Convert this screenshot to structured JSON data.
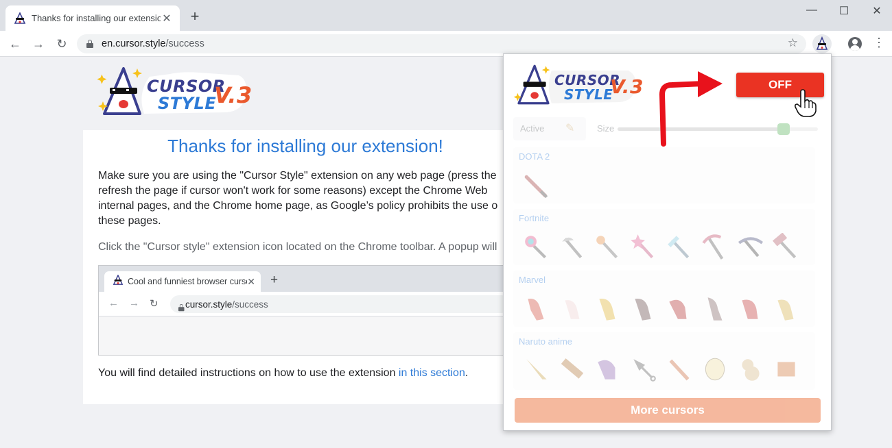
{
  "browser": {
    "tab_title": "Thanks for installing our extension",
    "url_host": "en.cursor.style",
    "url_path": "/success"
  },
  "page": {
    "logo": {
      "line1": "CURSOR",
      "line2": "STYLE",
      "version": "V.3"
    },
    "heading": "Thanks for installing our extension!",
    "para1": [
      "Make sure you are using the \"Cursor Style\" extension on any web page (press the",
      "refresh the page if cursor won't work for some reasons) except the Chrome Web",
      "internal pages, and the Chrome home page, as Google’s policy prohibits the use o",
      "these pages."
    ],
    "para2": "Click the \"Cursor style\" extension icon located on the Chrome toolbar. A popup will",
    "para3_prefix": "You will find detailed instructions on how to use the extension ",
    "para3_link": "in this section",
    "para3_suffix": "."
  },
  "mini_browser": {
    "tab_title": "Cool and funniest browser cursors",
    "url_host": "cursor.style",
    "url_path": "/success"
  },
  "popup": {
    "off_label": "OFF",
    "active_label": "Active",
    "size_label": "Size",
    "size_value": 0.85,
    "categories": [
      {
        "name": "DOTA 2",
        "count": 1
      },
      {
        "name": "Fortnite",
        "count": 8
      },
      {
        "name": "Marvel",
        "count": 8
      },
      {
        "name": "Naruto anime",
        "count": 8
      }
    ],
    "more_label": "More cursors"
  },
  "colors": {
    "accent": "#2d7ad6",
    "off_red": "#ea3323",
    "arrow_red": "#e8121c",
    "more_orange": "#ef8a5e"
  }
}
